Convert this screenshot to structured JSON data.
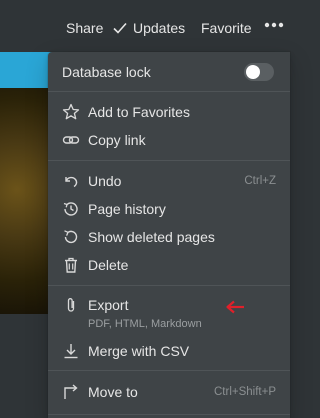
{
  "topbar": {
    "share": "Share",
    "updates": "Updates",
    "favorite": "Favorite",
    "more_icon": "more-horizontal-icon"
  },
  "menu": {
    "database_lock": {
      "label": "Database lock",
      "enabled": false
    },
    "add_to_favorites": {
      "label": "Add to Favorites",
      "icon": "star-icon"
    },
    "copy_link": {
      "label": "Copy link",
      "icon": "link-icon"
    },
    "undo": {
      "label": "Undo",
      "shortcut": "Ctrl+Z",
      "icon": "undo-icon"
    },
    "page_history": {
      "label": "Page history",
      "icon": "history-icon"
    },
    "show_deleted_pages": {
      "label": "Show deleted pages",
      "icon": "restore-icon"
    },
    "delete": {
      "label": "Delete",
      "icon": "trash-icon"
    },
    "export": {
      "label": "Export",
      "description": "PDF, HTML, Markdown",
      "icon": "paperclip-icon"
    },
    "merge_with_csv": {
      "label": "Merge with CSV",
      "icon": "import-icon"
    },
    "move_to": {
      "label": "Move to",
      "shortcut": "Ctrl+Shift+P",
      "icon": "move-to-icon"
    }
  },
  "annotation": {
    "arrow_color": "#e0202a"
  },
  "colors": {
    "menu_bg": "#3f4447",
    "page_bg": "#2f3437",
    "cover_accent": "#2aa6d6"
  }
}
